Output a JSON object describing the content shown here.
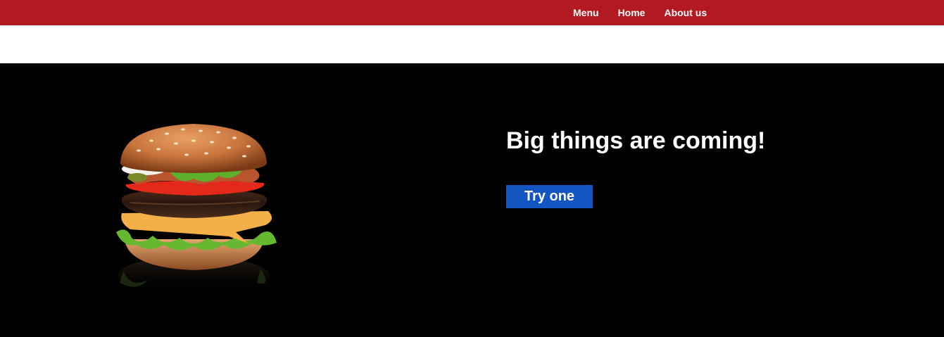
{
  "nav": {
    "items": [
      {
        "label": "Menu"
      },
      {
        "label": "Home"
      },
      {
        "label": "About us"
      }
    ]
  },
  "hero": {
    "headline": "Big things are coming!",
    "cta_label": "Try one",
    "image": "burger-image"
  },
  "colors": {
    "topbar": "#b31920",
    "hero_bg": "#000000",
    "cta_bg": "#1356c2",
    "text_light": "#ffffff"
  }
}
